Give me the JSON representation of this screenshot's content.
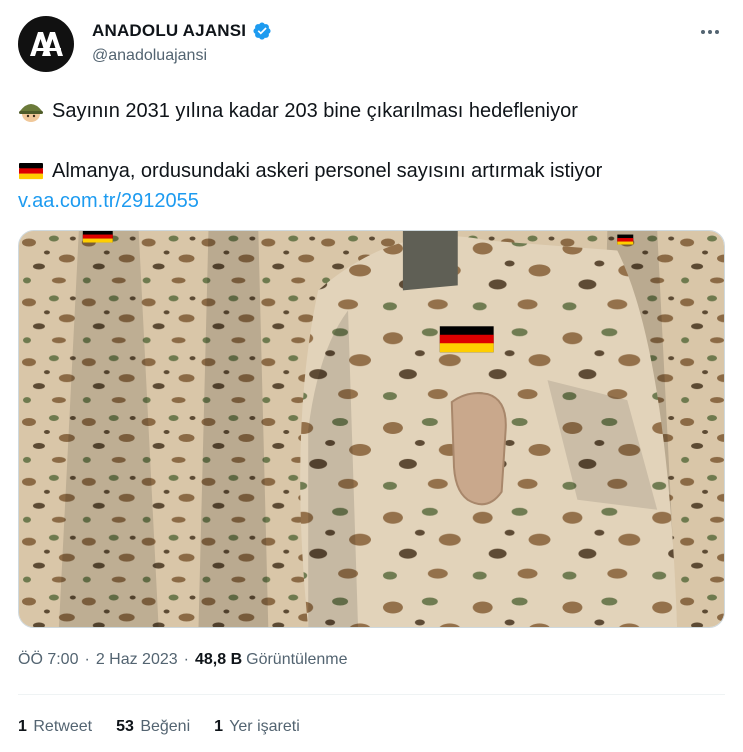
{
  "author": {
    "display_name": "ANADOLU AJANSI",
    "handle": "@anadoluajansi",
    "avatar_icon": "anadolu-ajansi-logo",
    "verified_icon": "verified-badge-icon",
    "verified_color": "#1d9bf0"
  },
  "tweet": {
    "line1_emoji": "military-helmet-emoji",
    "line1": "Sayının 2031 yılına kadar 203 bine çıkarılması hedefleniyor",
    "line2_emoji": "germany-flag-emoji",
    "line2": "Almanya, ordusundaki askeri personel sayısını artırmak istiyor",
    "link": "v.aa.com.tr/2912055"
  },
  "media": {
    "icon": "soldiers-desert-camouflage-photo"
  },
  "meta": {
    "time": "ÖÖ 7:00",
    "date": "2 Haz 2023",
    "views_count": "48,8 B",
    "views_label": "Görüntülenme"
  },
  "stats": {
    "retweets_count": "1",
    "retweets_label": "Retweet",
    "likes_count": "53",
    "likes_label": "Beğeni",
    "bookmarks_count": "1",
    "bookmarks_label": "Yer işareti"
  },
  "colors": {
    "text": "#0f1419",
    "secondary": "#536471",
    "link": "#1d9bf0"
  }
}
